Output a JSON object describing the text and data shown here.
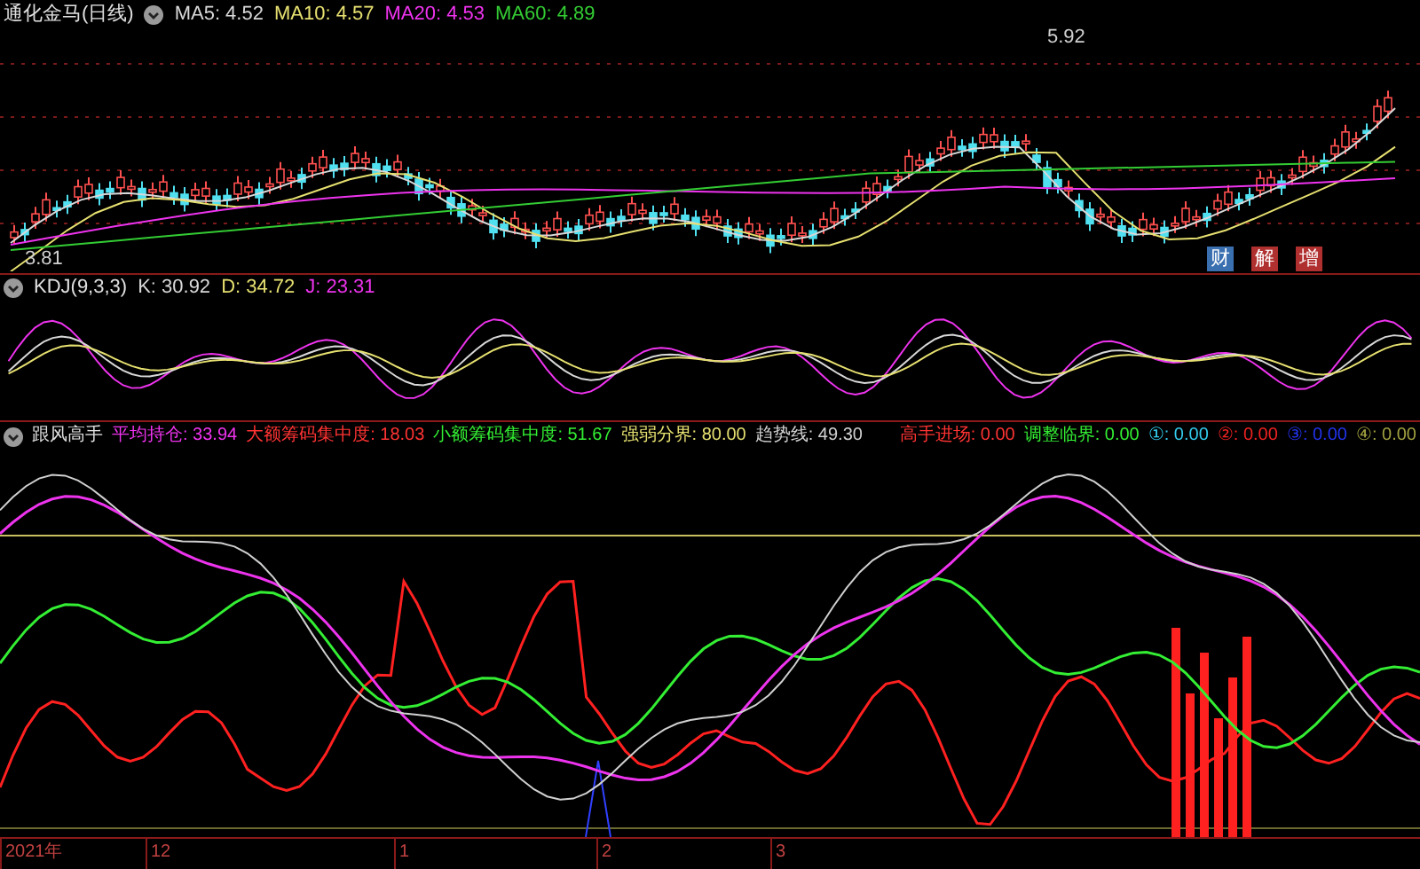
{
  "price_panel": {
    "title": "通化金马(日线)",
    "indicators": [
      {
        "label": "MA5: 4.52",
        "color": "#d8d8d8"
      },
      {
        "label": "MA10: 4.57",
        "color": "#e6e070"
      },
      {
        "label": "MA20: 4.53",
        "color": "#ee33ee"
      },
      {
        "label": "MA60: 4.89",
        "color": "#33cc33"
      }
    ],
    "high_label": "5.92",
    "low_label": "3.81",
    "event_tags": [
      {
        "text": "财",
        "color": "#3a6fb0"
      },
      {
        "text": "解",
        "color": "#b03030"
      },
      {
        "text": "增",
        "color": "#b03030"
      }
    ]
  },
  "kdj_panel": {
    "title": "KDJ(9,3,3)",
    "indicators": [
      {
        "label": "K: 30.92",
        "color": "#d8d8d8"
      },
      {
        "label": "D: 34.72",
        "color": "#e6e070"
      },
      {
        "label": "J: 23.31",
        "color": "#ee33ee"
      }
    ]
  },
  "indicator_panel": {
    "title": "跟风高手",
    "indicators": [
      {
        "label": "平均持仓: 33.94",
        "color": "#ee33ee"
      },
      {
        "label": "大额筹码集中度: 18.03",
        "color": "#ff3333"
      },
      {
        "label": "小额筹码集中度: 51.67",
        "color": "#33ee33"
      },
      {
        "label": "强弱分界: 80.00",
        "color": "#e6e070"
      },
      {
        "label": "趋势线: 49.30",
        "color": "#d0d0d0"
      }
    ],
    "signals": [
      {
        "label": "高手进场: 0.00",
        "color": "#ff3333"
      },
      {
        "label": "调整临界: 0.00",
        "color": "#33ee33"
      },
      {
        "label": "①: 0.00",
        "color": "#33ccee"
      },
      {
        "label": "②: 0.00",
        "color": "#ee2222"
      },
      {
        "label": "③: 0.00",
        "color": "#2233ee"
      },
      {
        "label": "④: 0.00",
        "color": "#a0a040"
      }
    ]
  },
  "time_axis": {
    "labels": [
      "2021年",
      "12",
      "1",
      "2",
      "3"
    ]
  }
}
